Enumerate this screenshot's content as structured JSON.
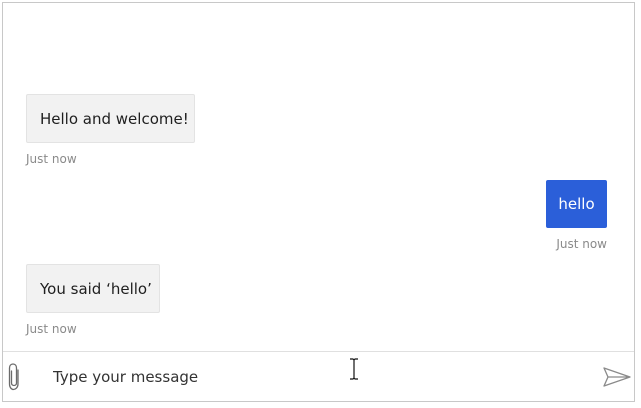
{
  "colors": {
    "user_bubble": "#2b5fd9",
    "bot_bubble": "#f2f2f2",
    "timestamp": "#8a8a8a",
    "border": "#c8c8c8"
  },
  "transcript": {
    "messages": [
      {
        "from": "bot",
        "text": "Hello and welcome!",
        "time": "Just now"
      },
      {
        "from": "user",
        "text": "hello",
        "time": "Just now"
      },
      {
        "from": "bot",
        "text": "You said ‘hello’",
        "time": "Just now"
      }
    ]
  },
  "input": {
    "placeholder": "Type your message",
    "value": ""
  },
  "icons": {
    "attach": "paperclip-icon",
    "send": "send-icon",
    "cursor": "text-cursor-icon"
  }
}
